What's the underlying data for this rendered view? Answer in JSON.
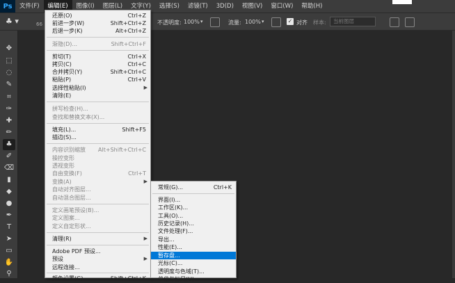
{
  "app": {
    "logo": "Ps"
  },
  "menubar": {
    "items": [
      "文件(F)",
      "编辑(E)",
      "图像(I)",
      "图层(L)",
      "文字(Y)",
      "选择(S)",
      "滤镜(T)",
      "3D(D)",
      "视图(V)",
      "窗口(W)",
      "帮助(H)"
    ]
  },
  "options": {
    "brush_size": "66",
    "opacity_label": "不透明度:",
    "opacity_value": "100%",
    "flow_label": "流量:",
    "flow_value": "100%",
    "align_label": "对齐",
    "sample_label": "样本:",
    "sample_value": "当前图层"
  },
  "edit_menu": [
    {
      "label": "还原(O)",
      "shortcut": "Ctrl+Z",
      "disabled": false
    },
    {
      "label": "前进一步(W)",
      "shortcut": "Shift+Ctrl+Z",
      "disabled": false
    },
    {
      "label": "后退一步(K)",
      "shortcut": "Alt+Ctrl+Z",
      "disabled": false
    },
    {
      "label": "渐隐(D)...",
      "shortcut": "Shift+Ctrl+F",
      "disabled": true
    },
    {
      "label": "剪切(T)",
      "shortcut": "Ctrl+X",
      "disabled": false
    },
    {
      "label": "拷贝(C)",
      "shortcut": "Ctrl+C",
      "disabled": false
    },
    {
      "label": "合并拷贝(Y)",
      "shortcut": "Shift+Ctrl+C",
      "disabled": false
    },
    {
      "label": "粘贴(P)",
      "shortcut": "Ctrl+V",
      "disabled": false
    },
    {
      "label": "选择性粘贴(I)",
      "shortcut": "",
      "disabled": false,
      "submenu": true
    },
    {
      "label": "清除(E)",
      "shortcut": "",
      "disabled": false
    },
    {
      "label": "拼写检查(H)...",
      "shortcut": "",
      "disabled": true
    },
    {
      "label": "查找和替换文本(X)...",
      "shortcut": "",
      "disabled": true
    },
    {
      "label": "填充(L)...",
      "shortcut": "Shift+F5",
      "disabled": false
    },
    {
      "label": "描边(S)...",
      "shortcut": "",
      "disabled": false
    },
    {
      "label": "内容识别缩放",
      "shortcut": "Alt+Shift+Ctrl+C",
      "disabled": true
    },
    {
      "label": "操控变形",
      "shortcut": "",
      "disabled": true
    },
    {
      "label": "透视变形",
      "shortcut": "",
      "disabled": true
    },
    {
      "label": "自由变换(F)",
      "shortcut": "Ctrl+T",
      "disabled": true
    },
    {
      "label": "变换(A)",
      "shortcut": "",
      "disabled": true,
      "submenu": true
    },
    {
      "label": "自动对齐图层...",
      "shortcut": "",
      "disabled": true
    },
    {
      "label": "自动混合图层...",
      "shortcut": "",
      "disabled": true
    },
    {
      "label": "定义画笔预设(B)...",
      "shortcut": "",
      "disabled": true
    },
    {
      "label": "定义图案...",
      "shortcut": "",
      "disabled": true
    },
    {
      "label": "定义自定形状...",
      "shortcut": "",
      "disabled": true
    },
    {
      "label": "清理(R)",
      "shortcut": "",
      "disabled": false,
      "submenu": true
    },
    {
      "label": "Adobe PDF 预设...",
      "shortcut": "",
      "disabled": false
    },
    {
      "label": "预设",
      "shortcut": "",
      "disabled": false,
      "submenu": true
    },
    {
      "label": "远程连接...",
      "shortcut": "",
      "disabled": false
    },
    {
      "label": "颜色设置(G)...",
      "shortcut": "Shift+Ctrl+K",
      "disabled": false
    }
  ],
  "prefs_submenu": [
    {
      "label": "常规(G)...",
      "shortcut": "Ctrl+K"
    },
    {
      "label": "界面(I)...",
      "shortcut": ""
    },
    {
      "label": "工作区(K)...",
      "shortcut": ""
    },
    {
      "label": "工具(O)...",
      "shortcut": ""
    },
    {
      "label": "历史记录(H)...",
      "shortcut": ""
    },
    {
      "label": "文件处理(F)...",
      "shortcut": ""
    },
    {
      "label": "导出...",
      "shortcut": ""
    },
    {
      "label": "性能(E)...",
      "shortcut": ""
    },
    {
      "label": "暂存盘...",
      "shortcut": "",
      "highlighted": true
    },
    {
      "label": "光标(C)...",
      "shortcut": ""
    },
    {
      "label": "透明度与色域(T)...",
      "shortcut": ""
    },
    {
      "label": "单位与标尺(U)...",
      "shortcut": ""
    }
  ],
  "colors": {
    "highlight": "#0078d7",
    "menubar": "#3c3c3c",
    "canvas": "#282828"
  }
}
